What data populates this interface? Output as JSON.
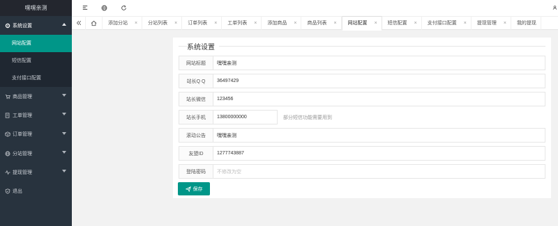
{
  "app": {
    "title": "嘿嘿亲测"
  },
  "sidebar": {
    "system_group": "系统设置",
    "sub_items": [
      "网站配置",
      "短信配置",
      "支付接口配置"
    ],
    "groups": [
      {
        "label": "商品管理",
        "icon": "cart-icon"
      },
      {
        "label": "工单管理",
        "icon": "ticket-icon"
      },
      {
        "label": "订单管理",
        "icon": "box-icon"
      },
      {
        "label": "分站管理",
        "icon": "globe-icon"
      },
      {
        "label": "提现管理",
        "icon": "pulse-icon"
      },
      {
        "label": "退出",
        "icon": "shield-icon"
      }
    ]
  },
  "tabs": [
    {
      "label": "添加分站"
    },
    {
      "label": "分站列表"
    },
    {
      "label": "订单列表"
    },
    {
      "label": "工单列表"
    },
    {
      "label": "添加商品"
    },
    {
      "label": "商品列表"
    },
    {
      "label": "网站配置"
    },
    {
      "label": "短信配置"
    },
    {
      "label": "支付接口配置"
    },
    {
      "label": "提现管理"
    },
    {
      "label": "我的提现"
    }
  ],
  "tab_close": "×",
  "form": {
    "legend": "系统设置",
    "fields": [
      {
        "label": "网站标题",
        "value": "嘿嘿亲测"
      },
      {
        "label": "站长Q Q",
        "value": "36497429"
      },
      {
        "label": "站长微信",
        "value": "123456"
      },
      {
        "label": "站长手机",
        "value": "13800000000",
        "hint": "部分短信功能需要用到"
      },
      {
        "label": "滚动公告",
        "value": "嘿嘿亲测"
      },
      {
        "label": "友盟ID",
        "value": "1277743887"
      },
      {
        "label": "登陆密码",
        "placeholder": "不修改为空"
      }
    ],
    "save_label": "保存"
  },
  "colors": {
    "accent": "#009688",
    "sidebar": "#28333e"
  }
}
